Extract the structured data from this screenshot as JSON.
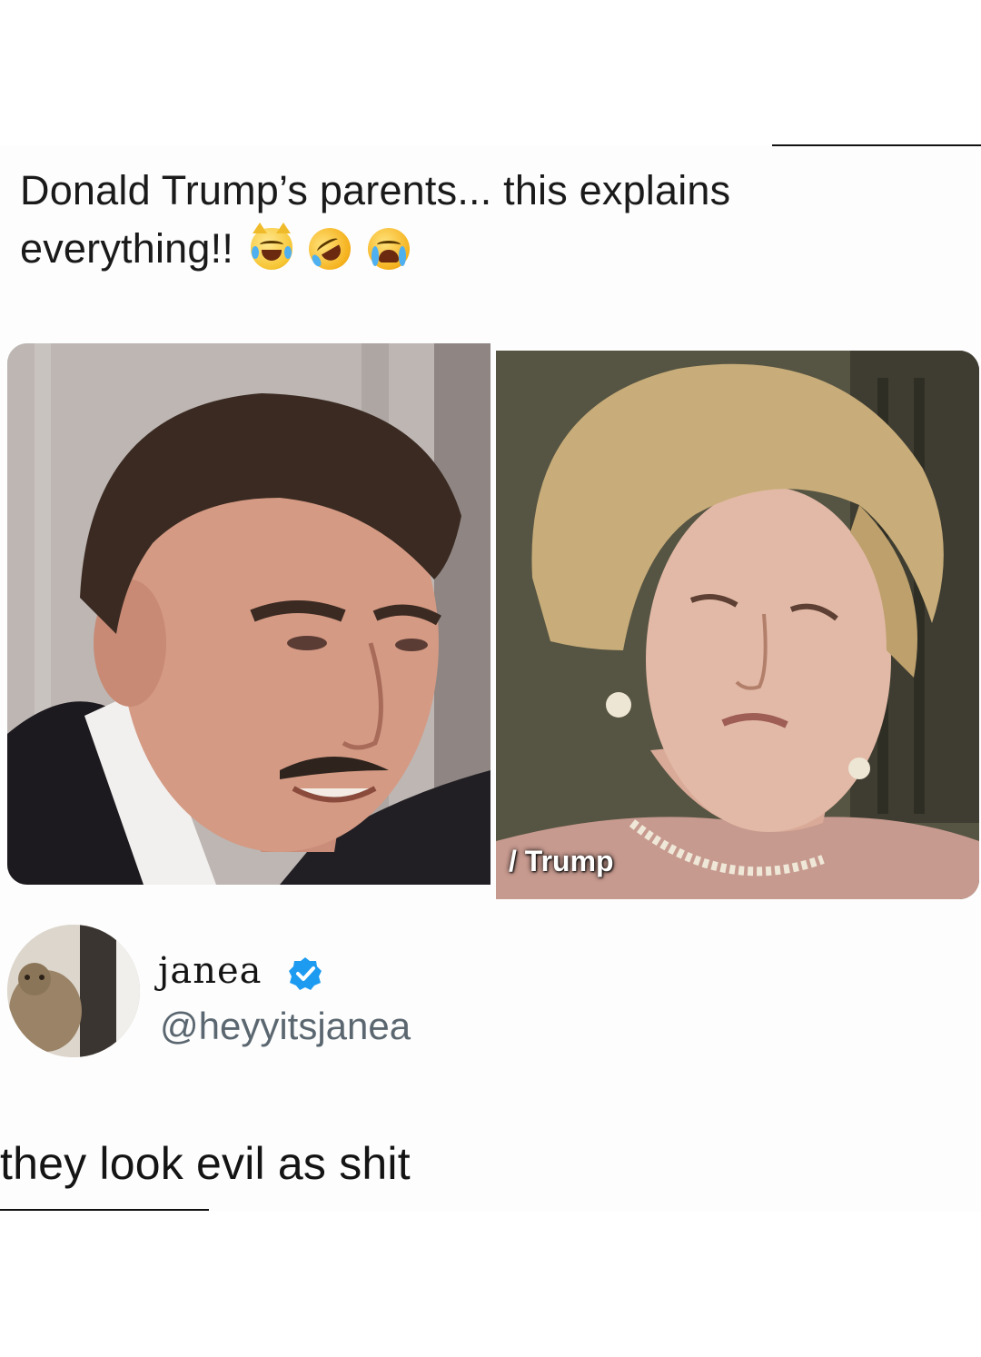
{
  "post": {
    "caption": "Donald Trump’s parents... this explains everything!!",
    "caption_emojis": [
      "crying-laughing-cat-icon",
      "rolling-on-floor-laughing-icon",
      "loudly-crying-face-icon"
    ]
  },
  "photos": {
    "right_overlay_text": "/ Trump"
  },
  "reply": {
    "display_name": "janea",
    "handle": "@heyyitsjanea",
    "verified_icon": "verified-badge-icon",
    "verified_color": "#1d9bf0",
    "text": "they look evil as shit"
  }
}
